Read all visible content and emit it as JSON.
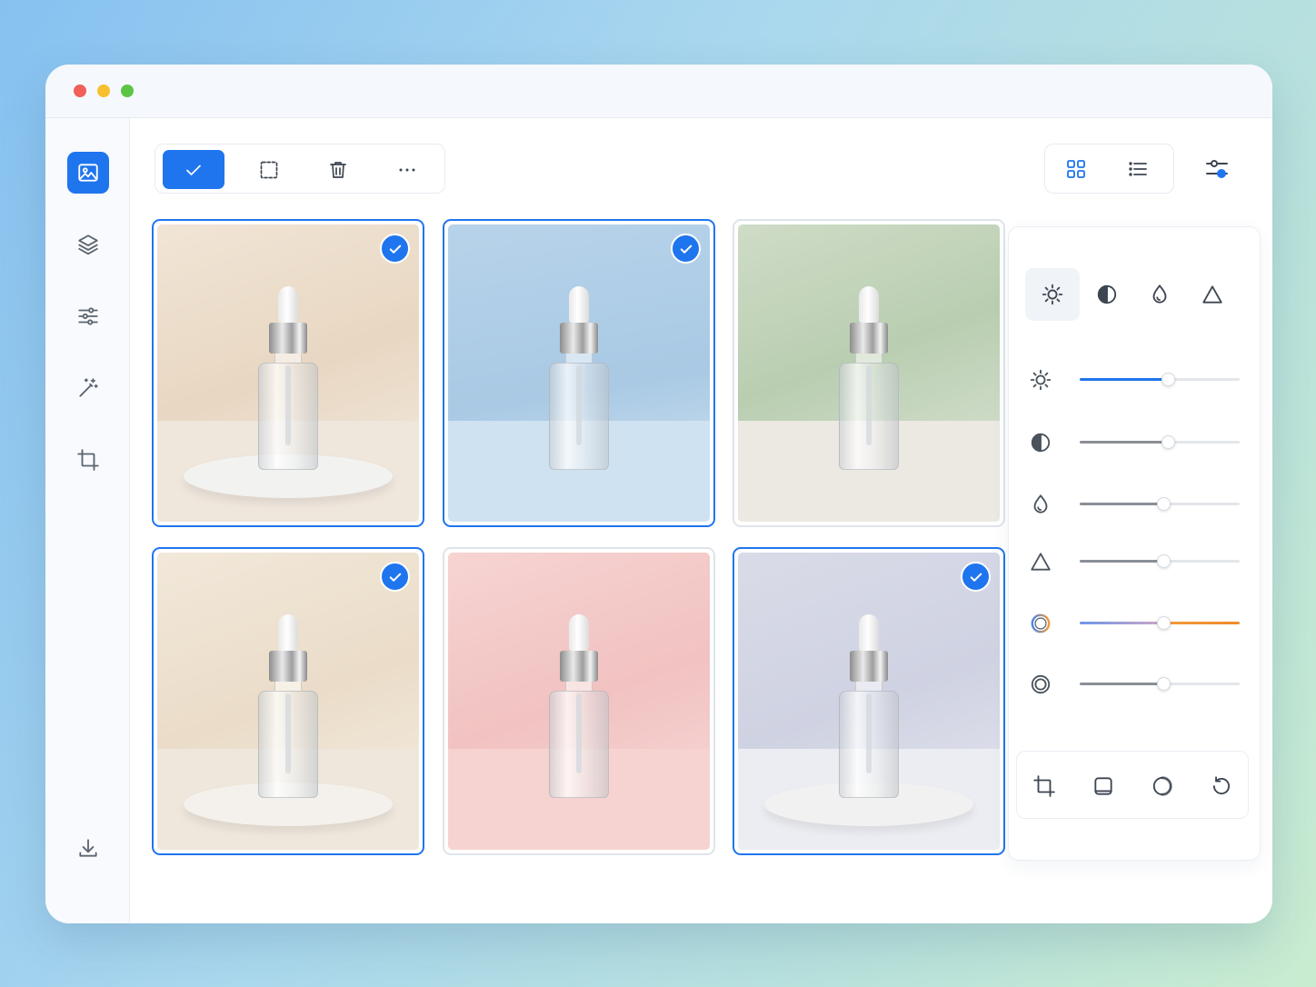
{
  "window": {
    "traffic_lights": {
      "close": "#f25f58",
      "minimize": "#f7c02e",
      "maximize": "#5dc545"
    }
  },
  "colors": {
    "accent": "#1f75ee",
    "icon": "#5b6470",
    "icon_light": "#ffffff"
  },
  "sidebar": {
    "items": [
      {
        "name": "gallery",
        "icon": "image-icon",
        "active": true
      },
      {
        "name": "layers",
        "icon": "layers-icon",
        "active": false
      },
      {
        "name": "adjustments",
        "icon": "sliders-icon",
        "active": false
      },
      {
        "name": "magic",
        "icon": "magic-wand-icon",
        "active": false
      },
      {
        "name": "crop",
        "icon": "crop-icon",
        "active": false
      }
    ],
    "bottom": {
      "name": "export",
      "icon": "download-icon"
    }
  },
  "toolbar": {
    "buttons": [
      {
        "name": "select-all",
        "icon": "check-icon",
        "active": true
      },
      {
        "name": "marquee",
        "icon": "marquee-select-icon",
        "active": false
      },
      {
        "name": "delete",
        "icon": "trash-icon",
        "active": false
      },
      {
        "name": "more",
        "icon": "more-horizontal-icon",
        "active": false
      }
    ]
  },
  "view": {
    "mode": "grid",
    "options": [
      "grid",
      "list"
    ]
  },
  "gallery": {
    "images": [
      {
        "theme": "beige",
        "selected": true
      },
      {
        "theme": "blue",
        "selected": true
      },
      {
        "theme": "green",
        "selected": false
      },
      {
        "theme": "cream",
        "selected": true
      },
      {
        "theme": "pink",
        "selected": false
      },
      {
        "theme": "lavender",
        "selected": true
      }
    ]
  },
  "adjust_panel": {
    "tabs": [
      {
        "name": "brightness",
        "icon": "sun-icon",
        "active": true
      },
      {
        "name": "contrast",
        "icon": "contrast-icon",
        "active": false
      },
      {
        "name": "saturation",
        "icon": "droplet-icon",
        "active": false
      },
      {
        "name": "sharpness",
        "icon": "triangle-icon",
        "active": false
      }
    ],
    "sliders": [
      {
        "name": "brightness",
        "icon": "sun-icon",
        "value": 0.55,
        "color": "#1f75ee"
      },
      {
        "name": "contrast",
        "icon": "contrast-icon",
        "value": 0.55,
        "color": "#8a8f96"
      },
      {
        "name": "saturation",
        "icon": "droplet-icon",
        "value": 0.52,
        "color": "#8a8f96"
      },
      {
        "name": "sharpness",
        "icon": "triangle-icon",
        "value": 0.52,
        "color": "#8a8f96"
      },
      {
        "name": "temperature",
        "icon": "temperature-icon",
        "value": 0.52,
        "color": "gradient"
      },
      {
        "name": "vignette",
        "icon": "vignette-icon",
        "value": 0.52,
        "color": "#8a8f96"
      }
    ],
    "tools": [
      {
        "name": "crop",
        "icon": "crop-icon"
      },
      {
        "name": "frame",
        "icon": "frame-icon"
      },
      {
        "name": "filter",
        "icon": "filter-circle-icon"
      },
      {
        "name": "reset",
        "icon": "rotate-ccw-icon"
      }
    ]
  }
}
